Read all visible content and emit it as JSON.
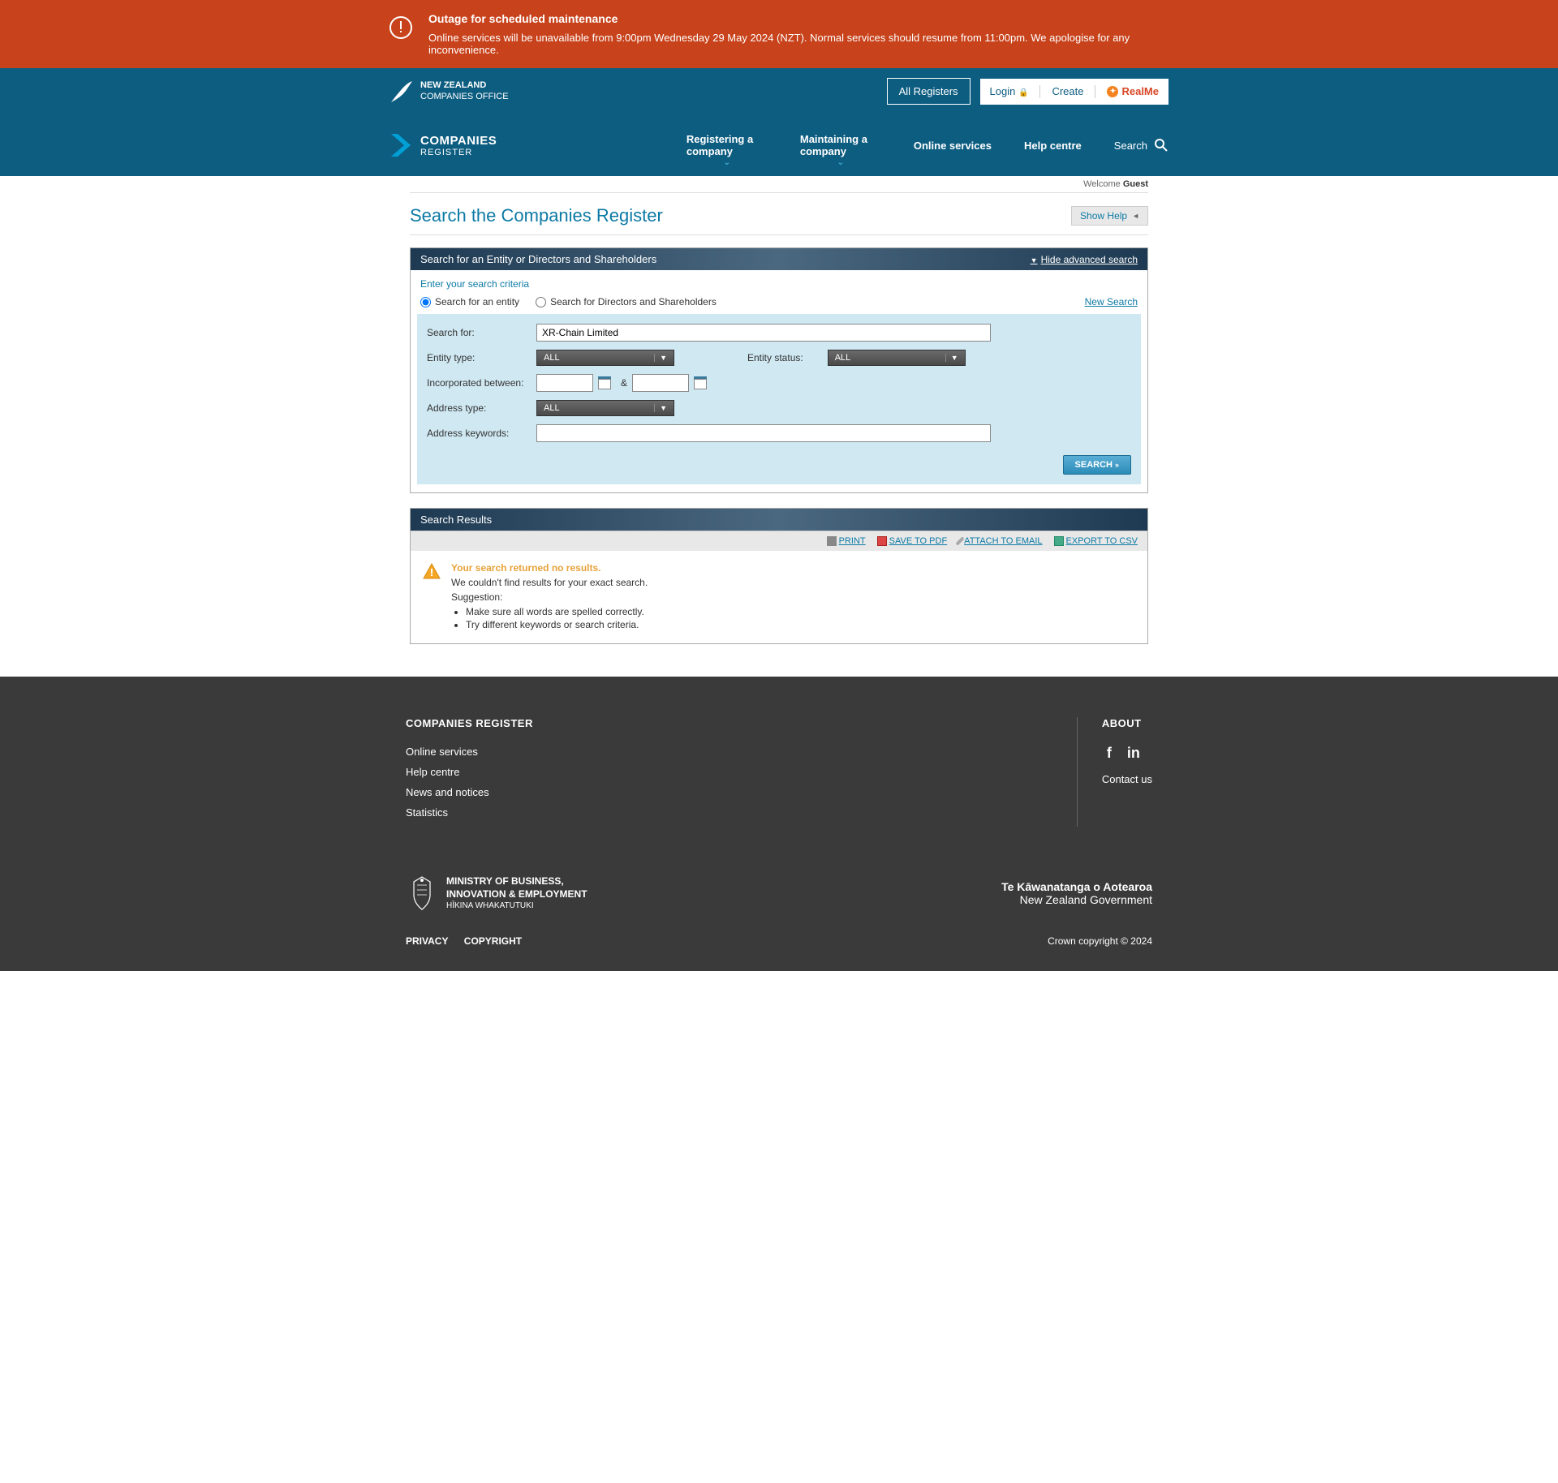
{
  "alert": {
    "title": "Outage for scheduled maintenance",
    "text": "Online services will be unavailable from 9:00pm Wednesday 29 May 2024 (NZT). Normal services should resume from 11:00pm. We apologise for any inconvenience."
  },
  "top_header": {
    "logo_line1": "NEW ZEALAND",
    "logo_line2": "COMPANIES OFFICE",
    "all_registers": "All Registers",
    "login": "Login",
    "create": "Create",
    "realme": "RealMe"
  },
  "nav": {
    "logo_line1": "COMPANIES",
    "logo_line2": "REGISTER",
    "items": [
      "Registering a company",
      "Maintaining a company",
      "Online services",
      "Help centre"
    ],
    "search": "Search"
  },
  "welcome": {
    "text": "Welcome ",
    "user": "Guest"
  },
  "page": {
    "title": "Search the Companies Register",
    "show_help": "Show Help"
  },
  "search_panel": {
    "header": "Search for an Entity or Directors and Shareholders",
    "hide_advanced": "Hide advanced search",
    "criteria_label": "Enter your search criteria",
    "radio1": "Search for an entity",
    "radio2": "Search for Directors and Shareholders",
    "new_search": "New Search",
    "labels": {
      "search_for": "Search for:",
      "entity_type": "Entity type:",
      "entity_status": "Entity status:",
      "incorporated": "Incorporated between:",
      "address_type": "Address type:",
      "address_keywords": "Address keywords:"
    },
    "values": {
      "search_for": "XR-Chain Limited",
      "entity_type": "ALL",
      "entity_status": "ALL",
      "date_from": "",
      "date_to": "",
      "address_type": "ALL",
      "address_keywords": ""
    },
    "amp": "&",
    "search_button": "SEARCH"
  },
  "results": {
    "header": "Search Results",
    "tools": {
      "print": "PRINT",
      "pdf": "SAVE TO PDF",
      "attach": "ATTACH TO EMAIL",
      "csv": "EXPORT TO CSV"
    },
    "no_results_title": "Your search returned no results.",
    "no_results_text": "We couldn't find results for your exact search.",
    "suggestion_label": "Suggestion:",
    "suggestions": [
      "Make sure all words are spelled correctly.",
      "Try different keywords or search criteria."
    ]
  },
  "footer": {
    "col1_title": "COMPANIES REGISTER",
    "col1_links": [
      "Online services",
      "Help centre",
      "News and notices",
      "Statistics"
    ],
    "col2_title": "ABOUT",
    "contact": "Contact us",
    "mbie_l1": "MINISTRY OF BUSINESS,",
    "mbie_l2": "INNOVATION & EMPLOYMENT",
    "mbie_l3": "HĪKINA WHAKATUTUKI",
    "nzgov_l1": "Te Kāwanatanga o Aotearoa",
    "nzgov_l2": "New Zealand Government",
    "privacy": "PRIVACY",
    "copyright_link": "COPYRIGHT",
    "crown": "Crown copyright © 2024"
  }
}
